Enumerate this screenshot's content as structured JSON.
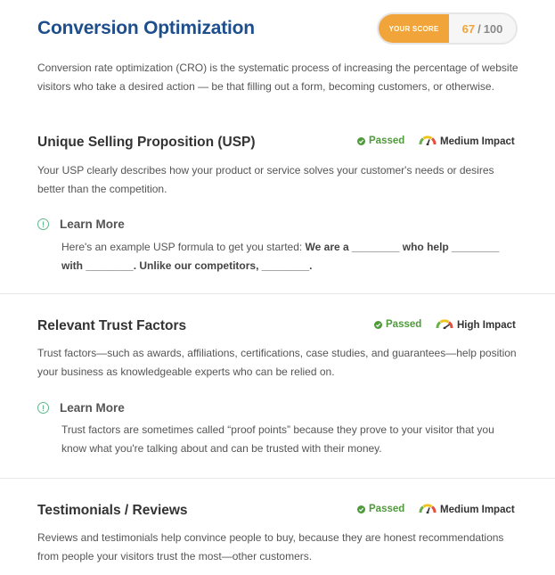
{
  "page": {
    "title": "Conversion Optimization",
    "score_label": "YOUR SCORE",
    "score_value": "67",
    "score_separator": "/",
    "score_max": "100",
    "intro": "Conversion rate optimization (CRO) is the systematic process of increasing the percentage of website visitors who take a desired action — be that filling out a form, becoming customers, or otherwise."
  },
  "colors": {
    "title": "#1f4e8c",
    "score_accent": "#f0a43a",
    "passed": "#4f9a3a",
    "info": "#5fb88a"
  },
  "sections": [
    {
      "title": "Unique Selling Proposition (USP)",
      "status": "Passed",
      "impact": "Medium Impact",
      "description": "Your USP clearly describes how your product or service solves your customer's needs or desires better than the competition.",
      "learn_more_label": "Learn More",
      "learn_more_text": "Here's an example USP formula to get you started: ",
      "learn_more_bold": "We are a ________ who help ________ with ________. Unlike our competitors, ________."
    },
    {
      "title": "Relevant Trust Factors",
      "status": "Passed",
      "impact": "High Impact",
      "description": "Trust factors—such as awards, affiliations, certifications, case studies, and guarantees—help position your business as knowledgeable experts who can be relied on.",
      "learn_more_label": "Learn More",
      "learn_more_text": "Trust factors are sometimes called “proof points” because they prove to your visitor that you know what you're talking about and can be trusted with their money."
    },
    {
      "title": "Testimonials / Reviews",
      "status": "Passed",
      "impact": "Medium Impact",
      "description": "Reviews and testimonials help convince people to buy, because they are honest recommendations from people your visitors trust the most—other customers."
    }
  ],
  "icons": {
    "passed": "check-circle-icon",
    "impact": "gauge-icon",
    "learn_more": "info-circle-icon"
  }
}
